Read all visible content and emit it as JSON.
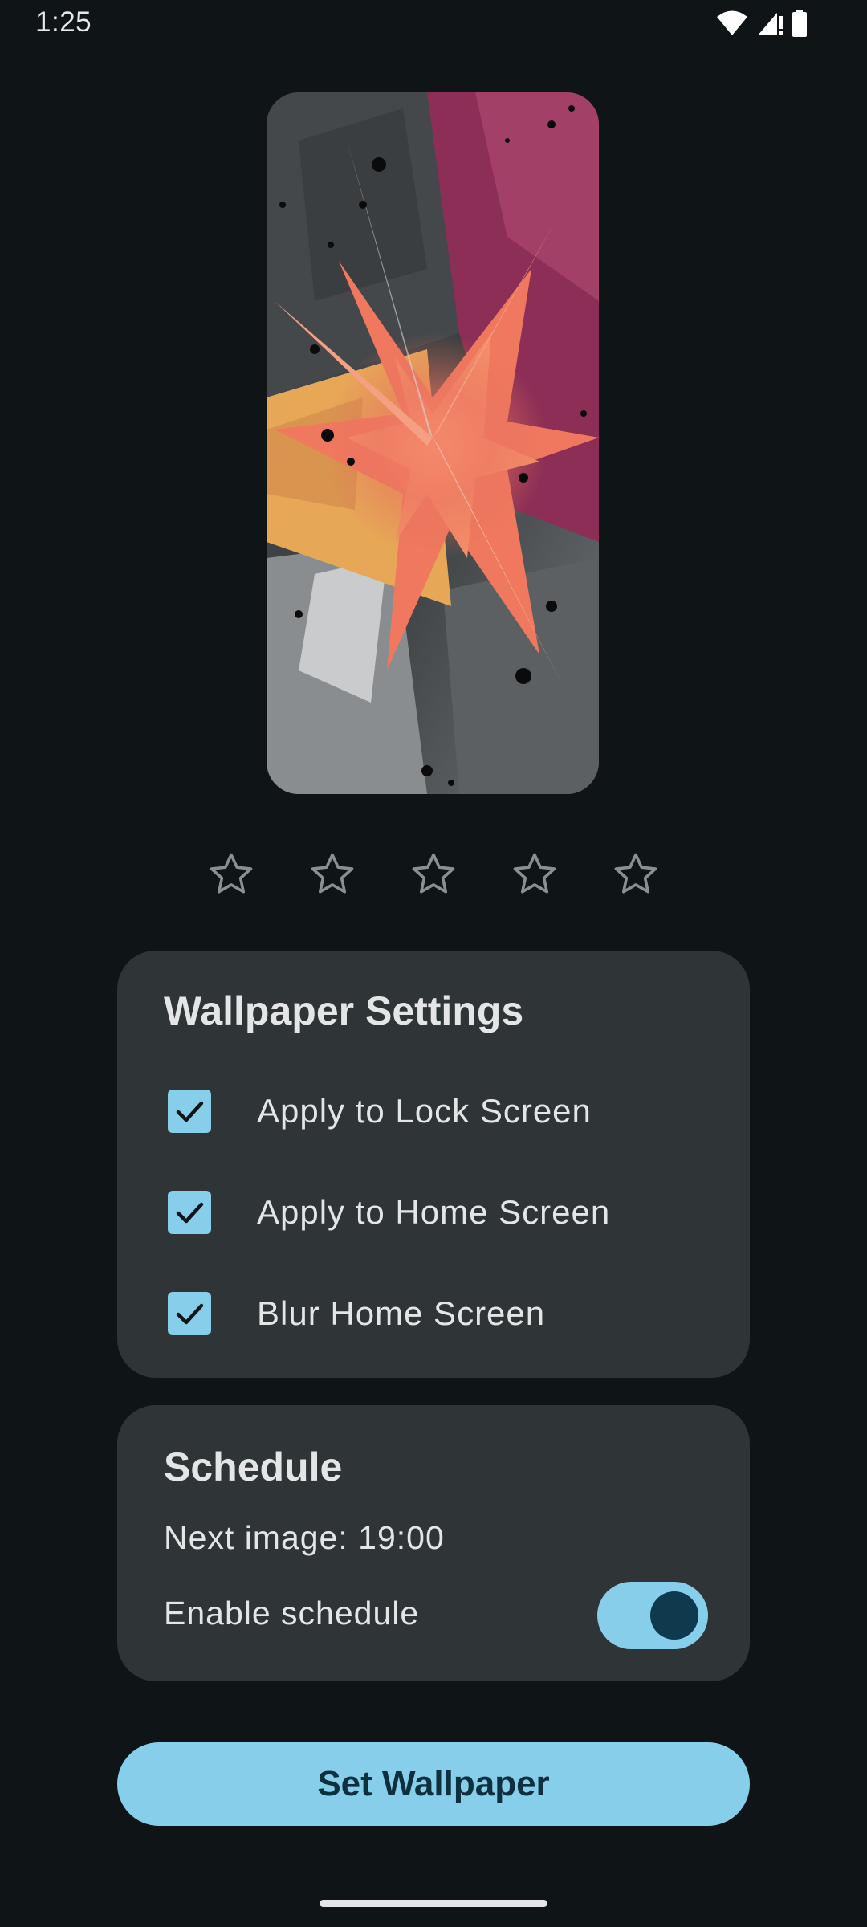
{
  "status_bar": {
    "time": "1:25",
    "icons": [
      "wifi-icon",
      "cellular-signal-icon",
      "battery-icon"
    ]
  },
  "preview": {
    "image": "abstract-shattered-geometric-wallpaper"
  },
  "rating": {
    "max": 5,
    "value": 0,
    "icon": "star-outline-icon"
  },
  "wallpaper_settings": {
    "title": "Wallpaper Settings",
    "options": [
      {
        "label": "Apply to Lock Screen",
        "checked": true
      },
      {
        "label": "Apply to Home Screen",
        "checked": true
      },
      {
        "label": "Blur Home Screen",
        "checked": true
      }
    ]
  },
  "schedule": {
    "title": "Schedule",
    "next_image": "Next image: 19:00",
    "enable_label": "Enable schedule",
    "enabled": true
  },
  "actions": {
    "set_wallpaper_label": "Set Wallpaper"
  },
  "colors": {
    "background": "#0F1417",
    "card": "#2F3437",
    "accent": "#87CEEB",
    "accent_dark": "#0F3A4D",
    "text": "#E3E5E7"
  }
}
